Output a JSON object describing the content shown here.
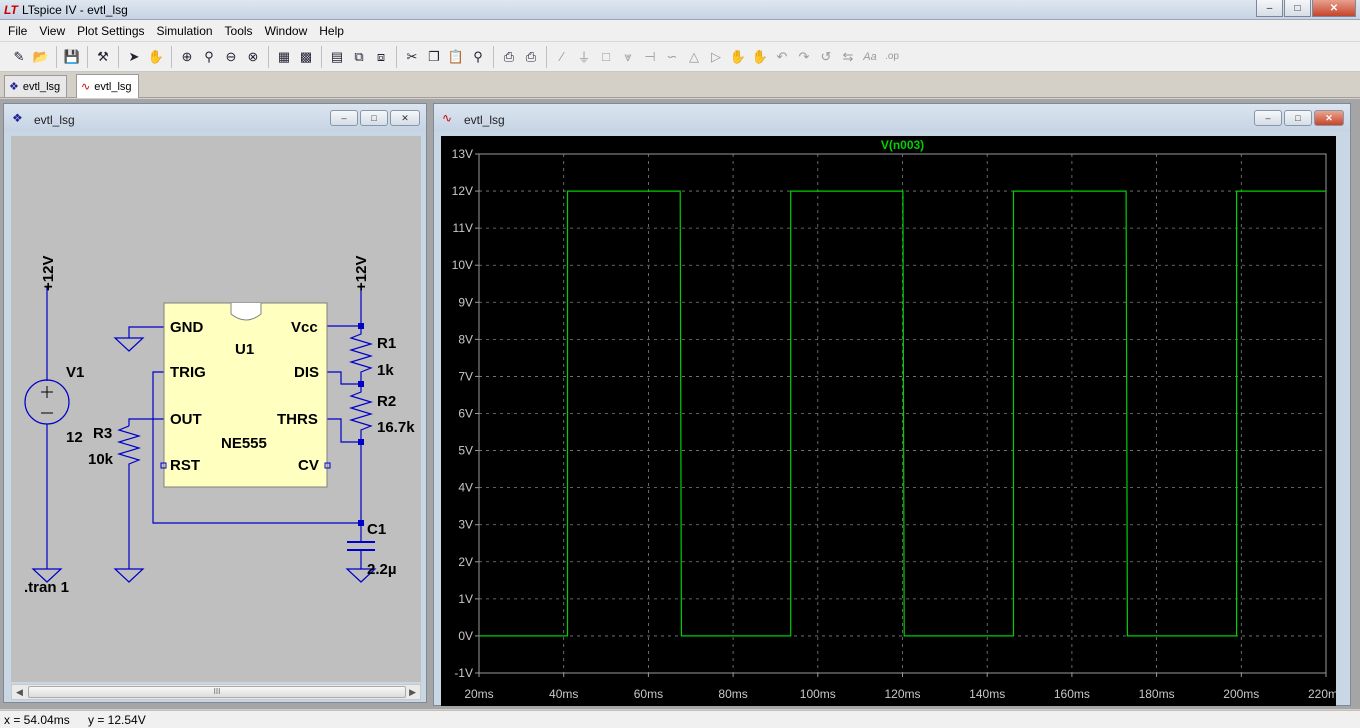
{
  "window": {
    "title": "LTspice IV - evtl_lsg",
    "min": "–",
    "max": "□",
    "close": "✕"
  },
  "menu": [
    "File",
    "View",
    "Plot Settings",
    "Simulation",
    "Tools",
    "Window",
    "Help"
  ],
  "tabs": [
    {
      "label": "evtl_lsg",
      "icon": "schematic-icon",
      "active": false
    },
    {
      "label": "evtl_lsg",
      "icon": "waveform-icon",
      "active": true
    }
  ],
  "schematic": {
    "title": "evtl_lsg",
    "supply_left": "+12V",
    "supply_right": "+12V",
    "v1_name": "V1",
    "v1_value": "12",
    "tran": ".tran 1",
    "r1_name": "R1",
    "r1_value": "1k",
    "r2_name": "R2",
    "r2_value": "16.7k",
    "r3_name": "R3",
    "r3_value": "10k",
    "c1_name": "C1",
    "c1_value": "2.2µ",
    "ic_name": "U1",
    "ic_part": "NE555",
    "pins": {
      "gnd": "GND",
      "trig": "TRIG",
      "out": "OUT",
      "rst": "RST",
      "vcc": "Vcc",
      "dis": "DIS",
      "thrs": "THRS",
      "cv": "CV"
    },
    "scroll_grip": "III"
  },
  "plot": {
    "title": "evtl_lsg",
    "trace_label": "V(n003)",
    "trace_color": "#00d000",
    "grid_color": "#808080",
    "axis_color": "#9a9a9a",
    "chart_data": {
      "type": "line",
      "series": [
        {
          "name": "V(n003)",
          "x": [
            "20ms",
            "40.9ms",
            "40.9ms",
            "67.5ms",
            "67.8ms",
            "93.6ms",
            "93.6ms",
            "120.1ms",
            "120.4ms",
            "146.2ms",
            "146.2ms",
            "172.8ms",
            "173.1ms",
            "198.9ms",
            "198.9ms",
            "220ms"
          ],
          "x_ms": [
            20,
            40.9,
            40.9,
            67.5,
            67.8,
            93.6,
            93.6,
            120.1,
            120.4,
            146.2,
            146.2,
            172.8,
            173.1,
            198.9,
            198.9,
            220
          ],
          "values": [
            0,
            0,
            12,
            12,
            0,
            0,
            12,
            12,
            0,
            0,
            12,
            12,
            0,
            0,
            12,
            12
          ]
        }
      ],
      "xlim_ms": [
        20,
        220
      ],
      "ylim": [
        -1,
        13
      ],
      "x_ticks": [
        "20ms",
        "40ms",
        "60ms",
        "80ms",
        "100ms",
        "120ms",
        "140ms",
        "160ms",
        "180ms",
        "200ms",
        "220ms"
      ],
      "y_ticks": [
        "13V",
        "12V",
        "11V",
        "10V",
        "9V",
        "8V",
        "7V",
        "6V",
        "5V",
        "4V",
        "3V",
        "2V",
        "1V",
        "0V",
        "-1V"
      ],
      "grid": true
    }
  },
  "status": {
    "x": "x = 54.04ms",
    "y": "y = 12.54V"
  }
}
